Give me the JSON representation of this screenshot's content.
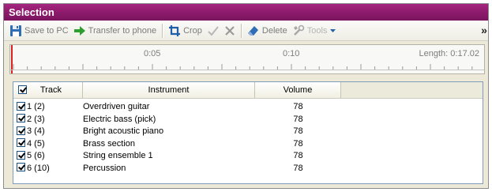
{
  "window": {
    "title": "Selection"
  },
  "toolbar": {
    "save_label": "Save to PC",
    "transfer_label": "Transfer to phone",
    "crop_label": "Crop",
    "delete_label": "Delete",
    "tools_label": "Tools",
    "overflow_glyph": "»"
  },
  "timeline": {
    "marks": [
      "0:05",
      "0:10"
    ],
    "length_label": "Length: 0:17.02"
  },
  "table": {
    "columns": [
      "Track",
      "Instrument",
      "Volume"
    ],
    "rows": [
      {
        "track": "1 (2)",
        "instrument": "Overdriven guitar",
        "volume": "78"
      },
      {
        "track": "2 (3)",
        "instrument": "Electric bass (pick)",
        "volume": "78"
      },
      {
        "track": "3 (4)",
        "instrument": "Bright acoustic piano",
        "volume": "78"
      },
      {
        "track": "4 (5)",
        "instrument": "Brass section",
        "volume": "78"
      },
      {
        "track": "5 (6)",
        "instrument": "String ensemble 1",
        "volume": "78"
      },
      {
        "track": "6 (10)",
        "instrument": "Percussion",
        "volume": "78"
      }
    ]
  },
  "colors": {
    "titlebar": "#8b1a6b",
    "cursor": "#e02020",
    "accent": "#1f5fa8"
  }
}
